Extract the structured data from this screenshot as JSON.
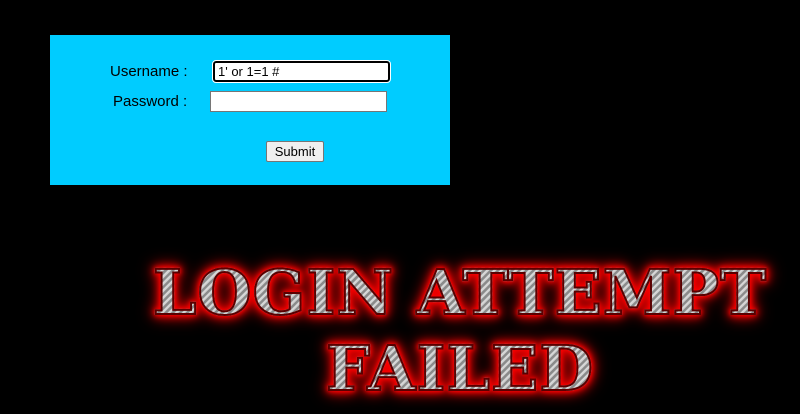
{
  "login_form": {
    "username_label": "Username :",
    "username_value": "1' or 1=1 #",
    "password_label": "Password :",
    "password_value": "",
    "submit_label": "Submit"
  },
  "banner": {
    "line1": "LOGIN ATTEMPT",
    "line2": "FAILED"
  },
  "colors": {
    "page_background": "#000000",
    "panel_background": "#00ccff",
    "banner_glow": "#ff0000",
    "banner_metal": "#b8b8b8"
  }
}
